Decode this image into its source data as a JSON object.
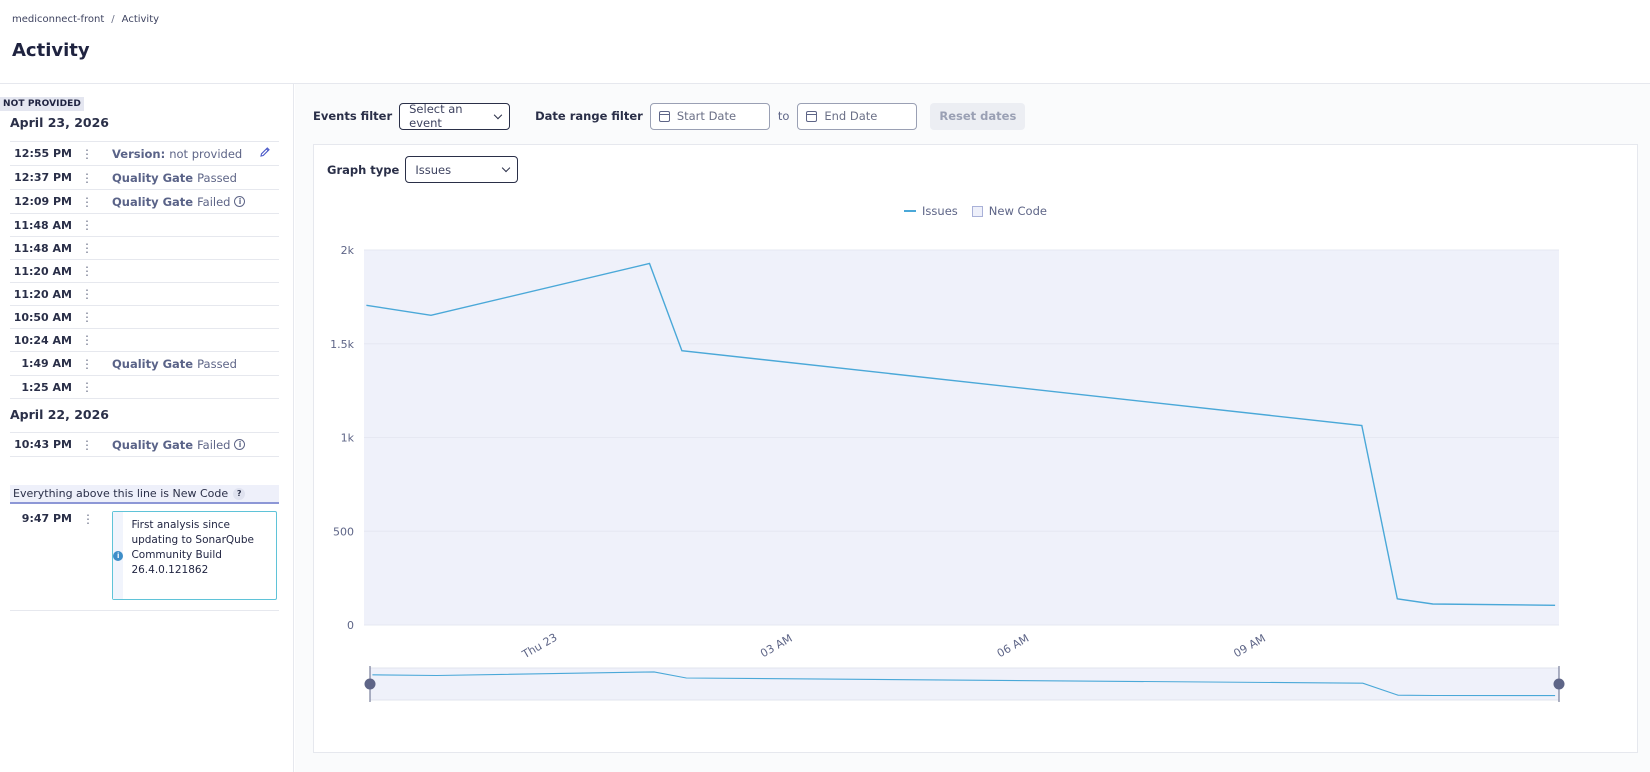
{
  "breadcrumb": {
    "project": "mediconnect-front",
    "separator": "/",
    "current": "Activity"
  },
  "page_title": "Activity",
  "sidebar": {
    "version_badge": "NOT PROVIDED",
    "days": [
      {
        "date": "April 23, 2026",
        "rows": [
          {
            "time": "12:55 PM",
            "label": "Version:",
            "value": "not provided",
            "editable": true
          },
          {
            "time": "12:37 PM",
            "label": "Quality Gate",
            "value": "Passed"
          },
          {
            "time": "12:09 PM",
            "label": "Quality Gate",
            "value": "Failed",
            "info": true
          },
          {
            "time": "11:48 AM"
          },
          {
            "time": "11:48 AM"
          },
          {
            "time": "11:20 AM"
          },
          {
            "time": "11:20 AM"
          },
          {
            "time": "10:50 AM"
          },
          {
            "time": "10:24 AM"
          },
          {
            "time": "1:49 AM",
            "label": "Quality Gate",
            "value": "Passed"
          },
          {
            "time": "1:25 AM"
          }
        ]
      },
      {
        "date": "April 22, 2026",
        "rows": [
          {
            "time": "10:43 PM",
            "label": "Quality Gate",
            "value": "Failed",
            "info": true
          }
        ]
      }
    ],
    "new_code_line": "Everything above this line is New Code",
    "new_code_help": "?",
    "first_analysis": {
      "time": "9:47 PM",
      "message": "First analysis since updating to SonarQube Community Build 26.4.0.121862"
    },
    "kebab": "⋮",
    "edit_icon": "pencil-icon",
    "info_glyph": "i"
  },
  "filters": {
    "events_label": "Events filter",
    "events_placeholder": "Select an event",
    "date_range_label": "Date range filter",
    "start_placeholder": "Start Date",
    "to_label": "to",
    "end_placeholder": "End Date",
    "reset_label": "Reset dates"
  },
  "graph": {
    "type_label": "Graph type",
    "type_value": "Issues",
    "legend": {
      "series": "Issues",
      "new_code": "New Code"
    }
  },
  "colors": {
    "line": "#4aa8d8",
    "plot_bg": "#eff1fa",
    "grid": "#e6e8f2",
    "text": "#5e6587"
  },
  "chart_data": {
    "type": "line",
    "title": "",
    "xlabel": "",
    "ylabel": "",
    "ylim": [
      0,
      2000
    ],
    "y_ticks": [
      0,
      500,
      1000,
      1500,
      2000
    ],
    "y_tick_labels": [
      "0",
      "500",
      "1k",
      "1.5k",
      "2k"
    ],
    "x_tick_labels": [
      "Thu 23",
      "03 AM",
      "06 AM",
      "09 AM"
    ],
    "x_tick_hours": [
      0,
      3,
      6,
      9
    ],
    "xlim_hours": [
      -2.25,
      12.9
    ],
    "series": [
      {
        "name": "Issues",
        "x_hours": [
          -2.22,
          -1.4,
          1.37,
          1.78,
          10.4,
          10.85,
          11.3,
          12.85
        ],
        "y": [
          1705,
          1652,
          1928,
          1463,
          1064,
          140,
          112,
          105
        ]
      }
    ],
    "new_code_shaded": true,
    "grid": true
  }
}
